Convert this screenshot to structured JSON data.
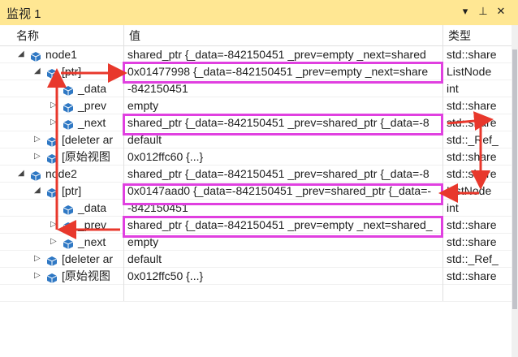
{
  "window": {
    "title": "监视 1",
    "dropdown_icon": "chevron-down-icon",
    "pin_icon": "pin-icon",
    "close_icon": "close-icon"
  },
  "columns": {
    "name": "名称",
    "value": "值",
    "type": "类型"
  },
  "rows": [
    {
      "name": "node1",
      "value": "shared_ptr {_data=-842150451 _prev=empty _next=shared",
      "type": "std::share",
      "expand": "open"
    },
    {
      "name": "[ptr]",
      "value": "0x01477998 {_data=-842150451 _prev=empty _next=share",
      "type": "ListNode",
      "expand": "open"
    },
    {
      "name": "_data",
      "value": "-842150451",
      "type": "int",
      "expand": "none"
    },
    {
      "name": "_prev",
      "value": "empty",
      "type": "std::share",
      "expand": "closed"
    },
    {
      "name": "_next",
      "value": "shared_ptr {_data=-842150451 _prev=shared_ptr {_data=-8",
      "type": "std::share",
      "expand": "closed"
    },
    {
      "name": "[deleter ar",
      "value": "default",
      "type": "std::_Ref_",
      "expand": "closed"
    },
    {
      "name": "[原始视图",
      "value": "0x012ffc60 {...}",
      "type": "std::share",
      "expand": "closed"
    },
    {
      "name": "node2",
      "value": "shared_ptr {_data=-842150451 _prev=shared_ptr {_data=-8",
      "type": "std::share",
      "expand": "open"
    },
    {
      "name": "[ptr]",
      "value": "0x0147aad0 {_data=-842150451 _prev=shared_ptr {_data=-",
      "type": "ListNode",
      "expand": "open"
    },
    {
      "name": "_data",
      "value": "-842150451",
      "type": "int",
      "expand": "none"
    },
    {
      "name": "_prev",
      "value": "shared_ptr {_data=-842150451 _prev=empty _next=shared_",
      "type": "std::share",
      "expand": "closed"
    },
    {
      "name": "_next",
      "value": "empty",
      "type": "std::share",
      "expand": "closed"
    },
    {
      "name": "[deleter ar",
      "value": "default",
      "type": "std::_Ref_",
      "expand": "closed"
    },
    {
      "name": "[原始视图",
      "value": "0x012ffc50 {...}",
      "type": "std::share",
      "expand": "closed"
    },
    {
      "name": "",
      "value": "",
      "type": "",
      "expand": "none"
    }
  ],
  "colors": {
    "titlebar": "#ffe793",
    "highlight": "#e040e0",
    "arrow": "#e8382c",
    "icon": "#2f78c4"
  }
}
